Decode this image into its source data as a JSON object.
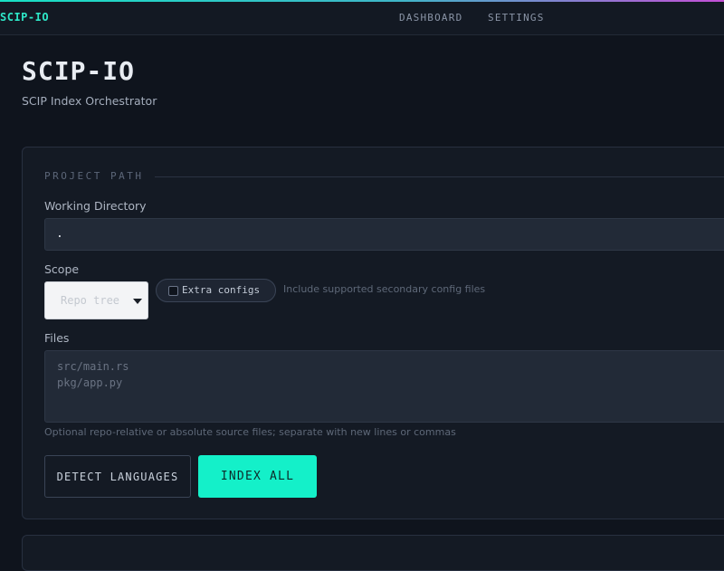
{
  "topbar": {
    "brand": "SCIP-IO",
    "nav": [
      "DASHBOARD",
      "SETTINGS"
    ]
  },
  "header": {
    "title": "SCIP-IO",
    "subtitle": "SCIP Index Orchestrator"
  },
  "project": {
    "section_title": "PROJECT PATH",
    "working_directory": {
      "label": "Working Directory",
      "value": "."
    },
    "scope": {
      "label": "Scope",
      "selected": "Repo tree",
      "extra_configs": {
        "label": "Extra configs",
        "checked": false,
        "hint": "Include supported secondary config files"
      }
    },
    "files": {
      "label": "Files",
      "placeholder_lines": [
        "src/main.rs",
        "pkg/app.py"
      ],
      "hint": "Optional repo-relative or absolute source files; separate with new lines or commas"
    },
    "actions": {
      "detect": "DETECT LANGUAGES",
      "index": "INDEX ALL"
    }
  },
  "colors": {
    "accent": "#14f0c9",
    "background": "#0f141d",
    "card": "#141a24"
  }
}
